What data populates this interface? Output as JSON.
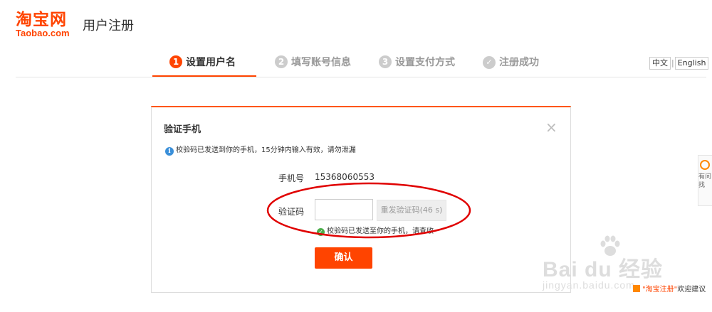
{
  "header": {
    "logo_cn": "淘宝网",
    "logo_en": "Taobao.com",
    "title": "用户注册"
  },
  "steps": [
    {
      "num": "1",
      "label": "设置用户名",
      "state": "active"
    },
    {
      "num": "2",
      "label": "填写账号信息",
      "state": "pending"
    },
    {
      "num": "3",
      "label": "设置支付方式",
      "state": "pending"
    },
    {
      "num": "✓",
      "label": "注册成功",
      "state": "pending"
    }
  ],
  "lang": {
    "cn": "中文",
    "separator": "|",
    "en": "English"
  },
  "dialog": {
    "title": "验证手机",
    "close_glyph": "×",
    "notice_icon": "i",
    "notice": "校验码已发送到你的手机，15分钟内输入有效，请勿泄漏",
    "phone_label": "手机号",
    "phone_value": "15368060553",
    "code_label": "验证码",
    "code_value": "",
    "resend_label": "重发验证码(46 s)",
    "hint": "校验码已发送至你的手机，请查收",
    "confirm_label": "确认"
  },
  "side_widget": {
    "line1": "有问",
    "line2": "找"
  },
  "watermark": {
    "main": "Bai du 经验",
    "sub": "jingyan.baidu.com"
  },
  "feedback": {
    "text_prefix": "\"淘宝注册\"",
    "text_suffix": "欢迎建议"
  },
  "colors": {
    "brand": "#ff4400",
    "annotation": "#e00000",
    "info": "#3a8fd9",
    "success": "#4cae4c"
  }
}
